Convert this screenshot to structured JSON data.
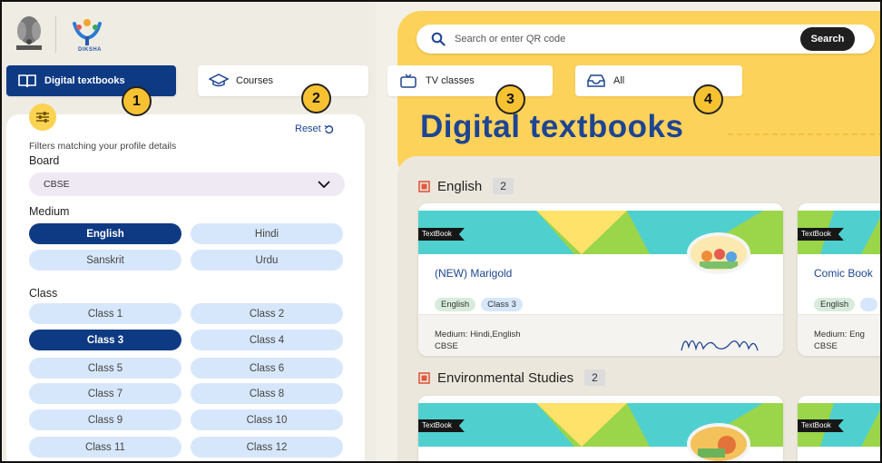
{
  "header": {
    "logo_text": "DIKSHA",
    "search": {
      "placeholder": "Search or enter QR code",
      "button_label": "Search"
    }
  },
  "tabs": [
    {
      "label": "Digital textbooks",
      "icon": "book-icon",
      "active": true
    },
    {
      "label": "Courses",
      "icon": "graduation-cap-icon",
      "active": false
    },
    {
      "label": "TV classes",
      "icon": "tv-icon",
      "active": false
    },
    {
      "label": "All",
      "icon": "tray-icon",
      "active": false
    }
  ],
  "annotations": [
    "1",
    "2",
    "3",
    "4"
  ],
  "page_title": "Digital textbooks",
  "filters": {
    "reset_label": "Reset",
    "note": "Filters matching your profile details",
    "board_label": "Board",
    "board_value": "CBSE",
    "medium_label": "Medium",
    "mediums": [
      "English",
      "Hindi",
      "Sanskrit",
      "Urdu"
    ],
    "selected_medium": "English",
    "class_label": "Class",
    "classes": [
      "Class 1",
      "Class 2",
      "Class 3",
      "Class 4",
      "Class 5",
      "Class 6",
      "Class 7",
      "Class 8",
      "Class 9",
      "Class 10",
      "Class 11",
      "Class 12"
    ],
    "selected_class": "Class 3"
  },
  "sections": [
    {
      "title": "English",
      "count": "2",
      "cards": [
        {
          "tag": "TextBook",
          "title": "(NEW) Marigold",
          "chips": [
            "English",
            "Class 3"
          ],
          "medium": "Medium: Hindi,English",
          "board": "CBSE"
        },
        {
          "tag": "TextBook",
          "title": "Comic Book",
          "chips": [
            "English"
          ],
          "medium": "Medium: Eng",
          "board": "CBSE"
        }
      ]
    },
    {
      "title": "Environmental Studies",
      "count": "2",
      "cards": [
        {
          "tag": "TextBook"
        },
        {
          "tag": "TextBook"
        }
      ]
    }
  ],
  "colors": {
    "primary": "#0e3a84",
    "accent_yellow": "#fdd25a",
    "badge": "#f7c232",
    "chip": "#d7e7fb"
  }
}
